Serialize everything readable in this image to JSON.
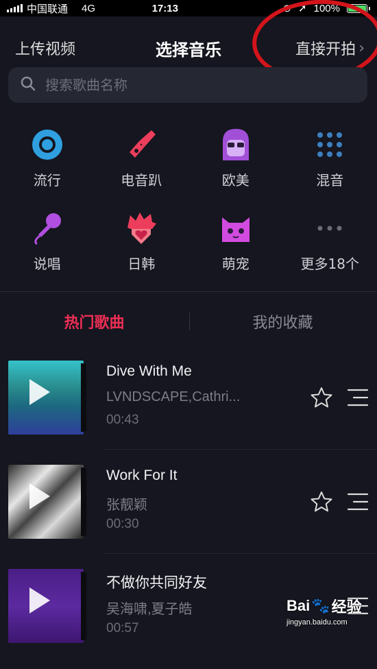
{
  "status_bar": {
    "carrier": "中国联通",
    "network": "4G",
    "time": "17:13",
    "battery": "100%"
  },
  "header": {
    "left_label": "上传视频",
    "title": "选择音乐",
    "right_label": "直接开拍",
    "right_chevron": "›"
  },
  "search": {
    "placeholder": "搜索歌曲名称"
  },
  "categories": [
    {
      "label": "流行",
      "icon": "disc-icon"
    },
    {
      "label": "电音趴",
      "icon": "guitar-icon"
    },
    {
      "label": "欧美",
      "icon": "sunglasses-face-icon"
    },
    {
      "label": "混音",
      "icon": "mixer-grid-icon"
    },
    {
      "label": "说唱",
      "icon": "microphone-icon"
    },
    {
      "label": "日韩",
      "icon": "spiky-hair-heart-icon"
    },
    {
      "label": "萌宠",
      "icon": "cat-icon"
    },
    {
      "label": "更多18个",
      "icon": "more-dots-icon"
    }
  ],
  "tabs": [
    {
      "label": "热门歌曲",
      "active": true
    },
    {
      "label": "我的收藏",
      "active": false
    }
  ],
  "songs": [
    {
      "title": "Dive With Me",
      "artist": "LVNDSCAPE,Cathri...",
      "duration": "00:43"
    },
    {
      "title": "Work For It",
      "artist": "张靓颖",
      "duration": "00:30"
    },
    {
      "title": "不做你共同好友",
      "artist": "吴海啸,夏子皓",
      "duration": "00:57"
    }
  ],
  "watermark": {
    "brand": "Bai",
    "brand_cn": "经验",
    "url": "jingyan.baidu.com"
  },
  "colors": {
    "background": "#15161f",
    "accent_active_tab": "#ee2e55",
    "annotation_circle": "#d4141b"
  }
}
